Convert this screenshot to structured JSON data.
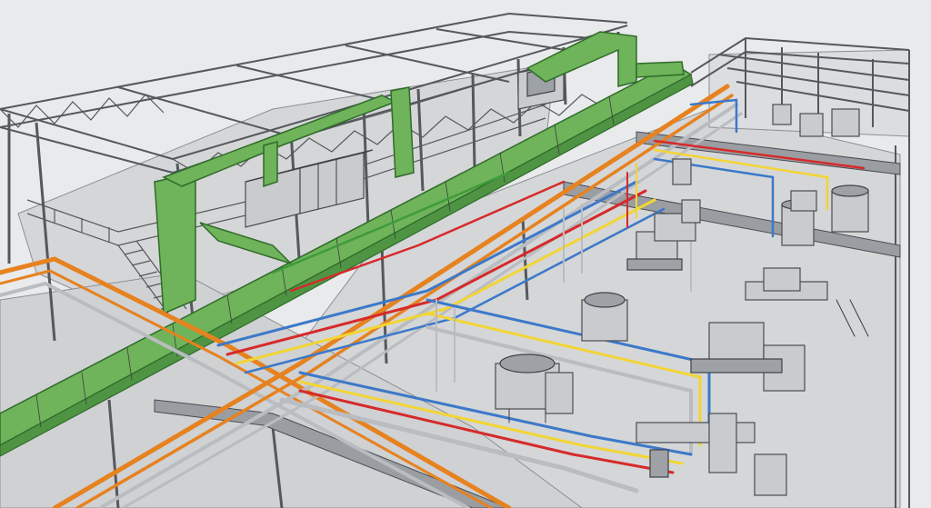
{
  "scene": {
    "colors": {
      "background": "#e9eaeb",
      "steel": "#55585c",
      "duct_green": "#6fb35a",
      "pipe_orange": "#e6821f",
      "pipe_blue": "#3c79c9",
      "pipe_red": "#d62a2a",
      "pipe_yellow": "#f2d534",
      "pipe_grey": "#b9bcc0",
      "equipment": "#c9cbce"
    }
  }
}
